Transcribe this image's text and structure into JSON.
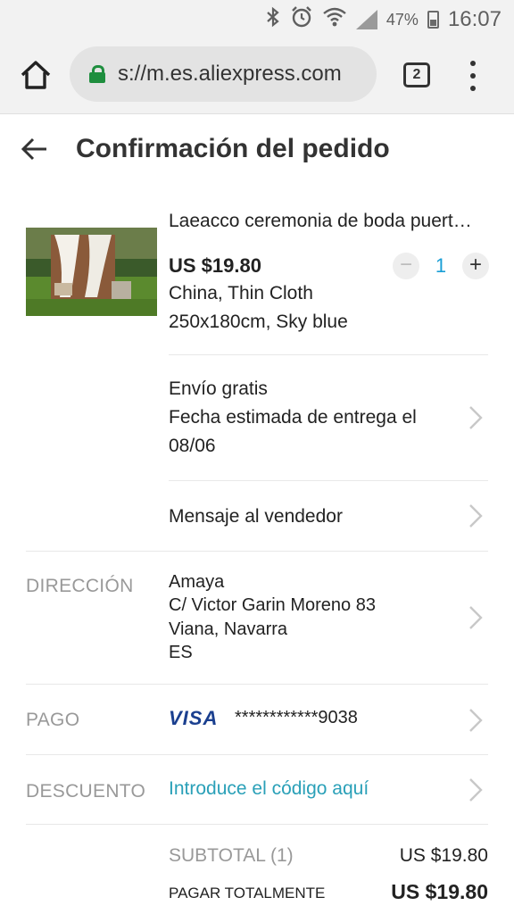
{
  "status_bar": {
    "battery": "47%",
    "time": "16:07",
    "icons": [
      "bluetooth-icon",
      "alarm-icon",
      "wifi-icon",
      "signal-icon",
      "battery-icon"
    ]
  },
  "browser": {
    "url": "s://m.es.aliexpress.com",
    "tab_count": "2"
  },
  "header": {
    "title": "Confirmación del pedido"
  },
  "product": {
    "title": "Laeacco ceremonia de boda puert…",
    "price": "US $19.80",
    "quantity": "1",
    "minus": "−",
    "plus": "+",
    "variant_line1": "China,  Thin Cloth",
    "variant_line2": "250x180cm,  Sky blue"
  },
  "shipping": {
    "line1": "Envío gratis",
    "line2": "Fecha estimada de entrega el",
    "line3": "08/06"
  },
  "message": {
    "label": "Mensaje al vendedor"
  },
  "address": {
    "label": "DIRECCIÓN",
    "name": "Amaya",
    "street": "C/ Victor Garin Moreno 83",
    "city": "Viana, Navarra",
    "country": "ES"
  },
  "payment": {
    "label": "PAGO",
    "card_brand": "VISA",
    "card_number": "************9038"
  },
  "discount": {
    "label": "DESCUENTO",
    "placeholder": "Introduce el código aquí"
  },
  "summary": {
    "subtotal_label": "SUBTOTAL (1)",
    "subtotal_value": "US $19.80",
    "total_label": "PAGAR TOTALMENTE",
    "total_value": "US $19.80"
  },
  "colors": {
    "accent_link": "#2aa0b8",
    "quantity": "#1a9fd6",
    "visa_blue": "#1a3f8f",
    "secure_green": "#1e8e3e"
  }
}
